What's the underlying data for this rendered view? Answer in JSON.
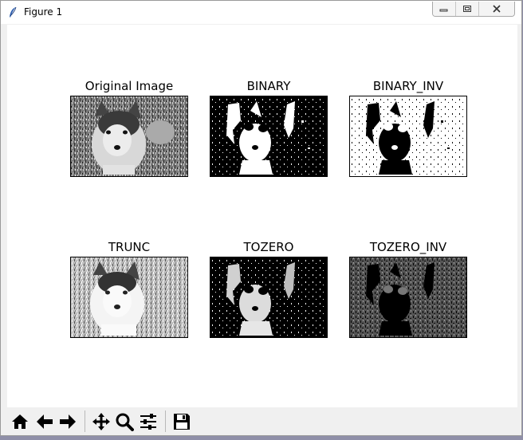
{
  "window": {
    "title": "Figure 1",
    "icons": [
      "feather-icon",
      "minimize-icon",
      "maximize-icon",
      "close-icon"
    ]
  },
  "figure": {
    "subplots": [
      {
        "label": "Original Image"
      },
      {
        "label": "BINARY"
      },
      {
        "label": "BINARY_INV"
      },
      {
        "label": "TRUNC"
      },
      {
        "label": "TOZERO"
      },
      {
        "label": "TOZERO_INV"
      }
    ]
  },
  "toolbar": {
    "buttons": [
      "home-icon",
      "back-icon",
      "forward-icon",
      "pan-icon",
      "zoom-icon",
      "configure-subplots-icon",
      "save-icon"
    ]
  }
}
